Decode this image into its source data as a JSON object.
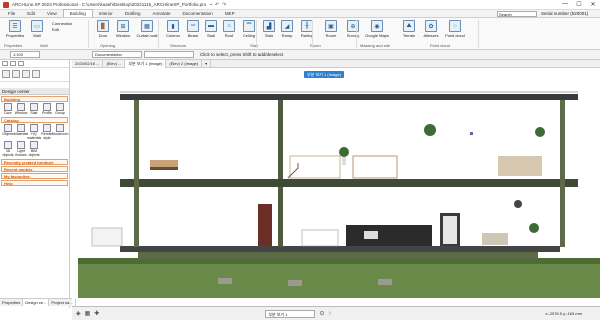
{
  "window": {
    "title": "ARCHLine.XP 2023 Professional - C:\\Users\\kuanh\\Desktop\\20221115_ARCHlineXP_Portfolio.pro",
    "min": "—",
    "max": "☐",
    "close": "✕"
  },
  "menu": {
    "tabs": [
      "File",
      "Edit",
      "View",
      "Building",
      "Interior",
      "Drafting",
      "Annotate",
      "Documentation",
      "MEP"
    ],
    "active": "Building",
    "search_placeholder": "Search",
    "serial": "Serial number (520001)"
  },
  "ribbon": {
    "buttons": [
      {
        "label": "Properties",
        "glyph": "☰"
      },
      {
        "label": "Wall",
        "glyph": "▭"
      },
      {
        "label": "Door",
        "glyph": "🚪"
      },
      {
        "label": "Window",
        "glyph": "⊞"
      },
      {
        "label": "Curtain wall",
        "glyph": "▦"
      },
      {
        "label": "Column",
        "glyph": "▮"
      },
      {
        "label": "Beam",
        "glyph": "═"
      },
      {
        "label": "Slab",
        "glyph": "▬"
      },
      {
        "label": "Roof",
        "glyph": "⌂"
      },
      {
        "label": "Ceiling",
        "glyph": "▔"
      },
      {
        "label": "Stair",
        "glyph": "▟"
      },
      {
        "label": "Ramp",
        "glyph": "◢"
      },
      {
        "label": "Railing",
        "glyph": "╫"
      },
      {
        "label": "Room",
        "glyph": "▣"
      },
      {
        "label": "Survey",
        "glyph": "⊕"
      },
      {
        "label": "Google Maps",
        "glyph": "◉"
      },
      {
        "label": "Terrain",
        "glyph": "⛰"
      },
      {
        "label": "Alleszes",
        "glyph": "✿"
      },
      {
        "label": "Point cloud",
        "glyph": "⁘"
      }
    ],
    "small_items": [
      "Connection",
      "Edit"
    ],
    "groups": [
      "Properties",
      "Wall",
      "Opening",
      "Structure",
      "Stair",
      "Room",
      "Massing and site",
      "Point cloud"
    ]
  },
  "toolbar2": {
    "scale_value": "1:100",
    "layer_value": "Documentation",
    "message": "Click to select, press Shift to add/deselect"
  },
  "left_panel": {
    "title": "Design center",
    "sections": {
      "building": "Building",
      "catalog": "Catalog",
      "recently_created": "Recently created furniture",
      "recent_models": "Recent models",
      "favourites": "My favourites",
      "help": "Help"
    },
    "building_items": [
      "Door",
      "Window",
      "Stair",
      "Profile",
      "Group"
    ],
    "catalog_items": [
      "Objects",
      "Materials",
      "HQ materials",
      "Render style",
      "Showroom",
      "3D objects",
      "Light fixtures",
      "BIM objects"
    ],
    "bottom_tabs": [
      "Properties",
      "Design ce...",
      "Project na..."
    ]
  },
  "view_tabs": [
    "2023/02/16 ...",
    "(Elev) ...",
    "부분 보기 1 (Image)",
    "(Elev) 2 (Image)",
    "▾"
  ],
  "viewport": {
    "badge": "부분 보기 1 (Image)"
  },
  "status": {
    "level": "부분 보기 1",
    "coordinates": "x:-2978.5   y:-163 mm"
  }
}
